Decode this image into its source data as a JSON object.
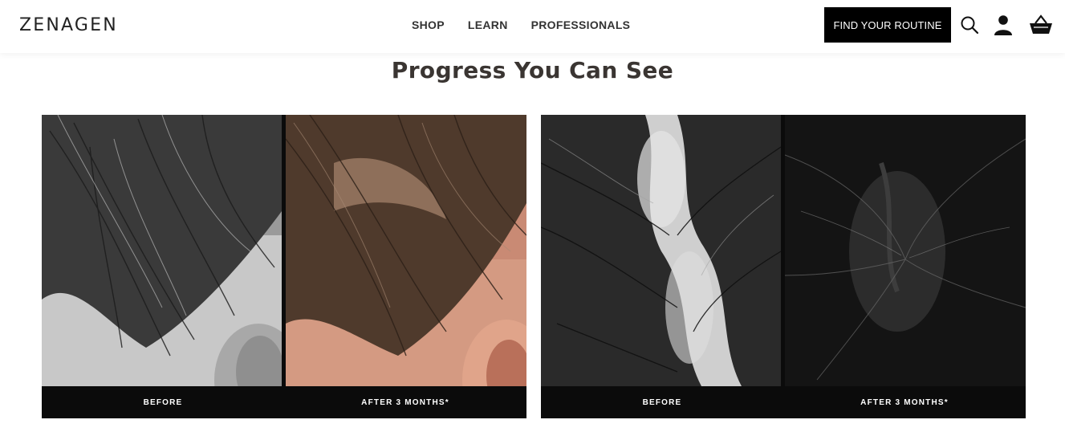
{
  "brand": {
    "logo_text": "ZENAGEN"
  },
  "nav": {
    "items": [
      {
        "label": "SHOP"
      },
      {
        "label": "LEARN"
      },
      {
        "label": "PROFESSIONALS"
      }
    ]
  },
  "header_actions": {
    "cta_label": "FIND YOUR ROUTINE",
    "icons": [
      "search-icon",
      "account-icon",
      "cart-icon"
    ]
  },
  "section": {
    "title": "Progress You Can See",
    "comparisons": [
      {
        "before_label": "BEFORE",
        "after_label": "AFTER 3 MONTHS*"
      },
      {
        "before_label": "BEFORE",
        "after_label": "AFTER 3 MONTHS*"
      }
    ]
  },
  "colors": {
    "text": "#2b2b2b",
    "button_bg": "#000000",
    "button_text": "#ffffff",
    "caption_bg": "#0b0b0b"
  }
}
